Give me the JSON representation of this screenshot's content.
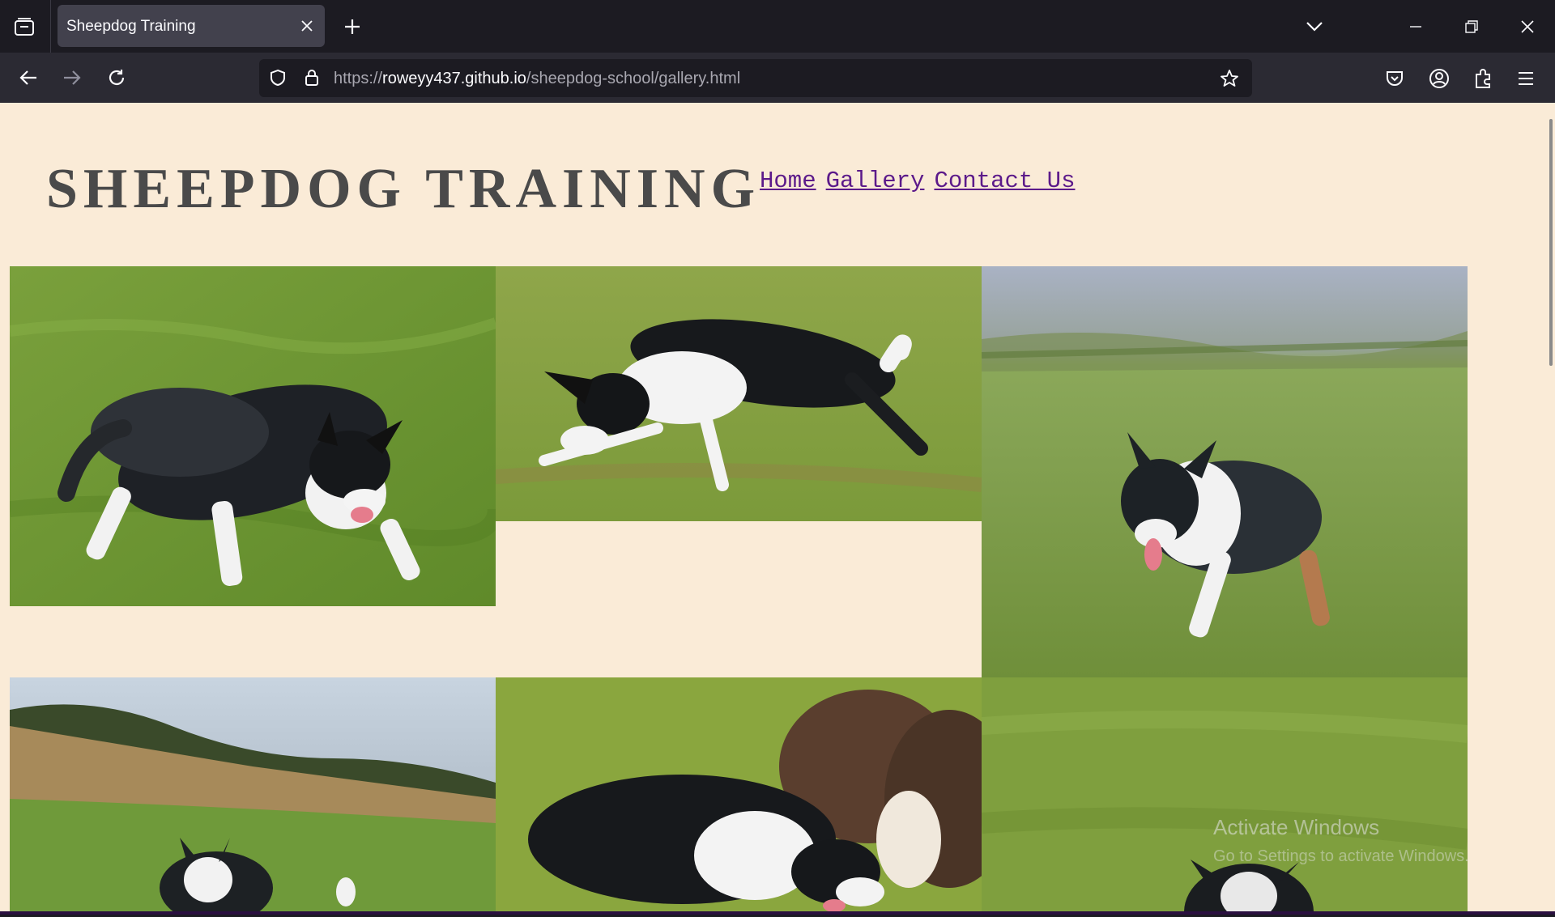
{
  "browser": {
    "tab_title": "Sheepdog Training",
    "url_scheme": "https://",
    "url_host": "roweyy437.github.io",
    "url_path": "/sheepdog-school/gallery.html"
  },
  "site": {
    "title": "SHEEPDOG TRAINING",
    "nav": [
      {
        "label": "Home"
      },
      {
        "label": "Gallery"
      },
      {
        "label": "Contact Us"
      }
    ]
  },
  "gallery": {
    "photos": [
      {
        "subject": "collie crouching on grass"
      },
      {
        "subject": "collie stalking low on grass"
      },
      {
        "subject": "collie walking in field with hills"
      },
      {
        "subject": "collie in hillside field"
      },
      {
        "subject": "collie beside brown sheep"
      },
      {
        "subject": "collie in green field"
      }
    ]
  },
  "overlay": {
    "line1": "Activate Windows",
    "line2": "Go to Settings to activate Windows."
  },
  "colors": {
    "page_background": "#faebd7",
    "link": "#5c1a8a",
    "title": "#4a4a4a"
  }
}
